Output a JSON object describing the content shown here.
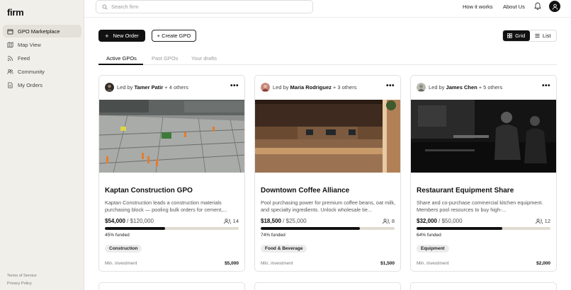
{
  "app": {
    "logo": "firm"
  },
  "sidebar": {
    "items": [
      {
        "label": "GPO Marketplace",
        "icon": "building-icon",
        "active": true
      },
      {
        "label": "Map View",
        "icon": "map-icon"
      },
      {
        "label": "Feed",
        "icon": "rss-icon"
      },
      {
        "label": "Community",
        "icon": "users-icon"
      },
      {
        "label": "My Orders",
        "icon": "document-icon"
      }
    ],
    "footer": {
      "terms": "Terms of Service",
      "privacy": "Privacy Policy"
    }
  },
  "topbar": {
    "search_placeholder": "Search firm",
    "how_it_works": "How it works",
    "about_us": "About Us"
  },
  "toolbar": {
    "new_order": "New Order",
    "create_gpo": "+ Create GPO",
    "grid": "Grid",
    "list": "List"
  },
  "tabs": [
    "Active GPOs",
    "Past GPOs",
    "Your drafts"
  ],
  "cards": [
    {
      "led_by_prefix": "Led by",
      "leader": "Tamer Patir",
      "others": "+ 4 others",
      "title": "Kaptan Construction GPO",
      "description": "Kaptan Construction leads a construction materials purchasing block — pooling bulk orders for cement,...",
      "raised": "$54,000",
      "goal": "/ $120,000",
      "members": "14",
      "funded_fraction": 0.45,
      "funded_label": "45% funded",
      "tag": "Construction",
      "min_label": "Min. investment",
      "min_value": "$5,000"
    },
    {
      "led_by_prefix": "Led by",
      "leader": "Maria Rodriguez",
      "others": "+ 3 others",
      "title": "Downtown Coffee Alliance",
      "description": "Pool purchasing power for premium coffee beans, oat milk, and specialty ingredients. Unlock wholesale tie...",
      "raised": "$18,500",
      "goal": "/ $25,000",
      "members": "8",
      "funded_fraction": 0.74,
      "funded_label": "74% funded",
      "tag": "Food & Beverage",
      "min_label": "Min. investment",
      "min_value": "$1,500"
    },
    {
      "led_by_prefix": "Led by",
      "leader": "James Chen",
      "others": "+ 5 others",
      "title": "Restaurant Equipment Share",
      "description": "Share and co-purchase commercial kitchen equipment. Members pool resources to buy high-...",
      "raised": "$32,000",
      "goal": "/ $50,000",
      "members": "12",
      "funded_fraction": 0.64,
      "funded_label": "64% funded",
      "tag": "Equipment",
      "min_label": "Min. investment",
      "min_value": "$2,000"
    }
  ],
  "colors": {
    "sidebar_bg": "#f1efea",
    "accent": "#111111",
    "progress_track": "#e0dbd0"
  }
}
